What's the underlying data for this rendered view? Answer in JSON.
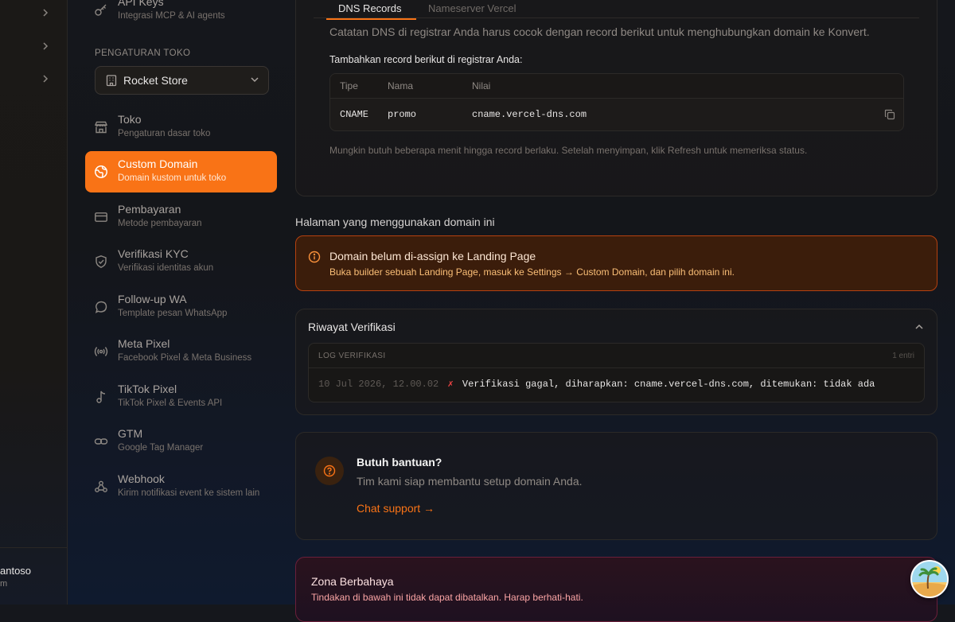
{
  "rail": {
    "user_name": "antoso",
    "user_sub": "m"
  },
  "sidebar": {
    "top_item": {
      "title": "API Keys",
      "subtitle": "Integrasi MCP & AI agents"
    },
    "section_label": "PENGATURAN TOKO",
    "store_select": {
      "value": "Rocket Store"
    },
    "items": [
      {
        "title": "Toko",
        "subtitle": "Pengaturan dasar toko",
        "icon": "store-icon"
      },
      {
        "title": "Custom Domain",
        "subtitle": "Domain kustom untuk toko",
        "icon": "globe-icon",
        "active": true
      },
      {
        "title": "Pembayaran",
        "subtitle": "Metode pembayaran",
        "icon": "credit-card-icon"
      },
      {
        "title": "Verifikasi KYC",
        "subtitle": "Verifikasi identitas akun",
        "icon": "shield-check-icon"
      },
      {
        "title": "Follow-up WA",
        "subtitle": "Template pesan WhatsApp",
        "icon": "chat-bubble-icon"
      },
      {
        "title": "Meta Pixel",
        "subtitle": "Facebook Pixel & Meta Business",
        "icon": "broadcast-icon"
      },
      {
        "title": "TikTok Pixel",
        "subtitle": "TikTok Pixel & Events API",
        "icon": "music-note-icon"
      },
      {
        "title": "GTM",
        "subtitle": "Google Tag Manager",
        "icon": "link-icon"
      },
      {
        "title": "Webhook",
        "subtitle": "Kirim notifikasi event ke sistem lain",
        "icon": "webhook-icon"
      }
    ]
  },
  "dns_card": {
    "tabs": [
      {
        "label": "DNS Records",
        "active": true
      },
      {
        "label": "Nameserver Vercel",
        "active": false
      }
    ],
    "description": "Catatan DNS di registrar Anda harus cocok dengan record berikut untuk menghubungkan domain ke Konvert.",
    "instruction": "Tambahkan record berikut di registrar Anda:",
    "table": {
      "headers": [
        "Tipe",
        "Nama",
        "Nilai"
      ],
      "rows": [
        {
          "type": "CNAME",
          "name": "promo",
          "value": "cname.vercel-dns.com"
        }
      ]
    },
    "note": "Mungkin butuh beberapa menit hingga record berlaku. Setelah menyimpan, klik Refresh untuk memeriksa status."
  },
  "pages_section": {
    "title": "Halaman yang menggunakan domain ini",
    "alert": {
      "title": "Domain belum di-assign ke Landing Page",
      "message": "Buka builder sebuah Landing Page, masuk ke Settings → Custom Domain, dan pilih domain ini."
    }
  },
  "verification": {
    "title": "Riwayat Verifikasi",
    "log_label": "LOG VERIFIKASI",
    "count": "1 entri",
    "entries": [
      {
        "time": "10 Jul 2026, 12.00.02",
        "mark": "✗",
        "message": "Verifikasi gagal, diharapkan: cname.vercel-dns.com, ditemukan: tidak ada"
      }
    ]
  },
  "help": {
    "title": "Butuh bantuan?",
    "subtitle": "Tim kami siap membantu setup domain Anda.",
    "link": "Chat support →"
  },
  "danger": {
    "title": "Zona Berbahaya",
    "subtitle": "Tindakan di bawah ini tidak dapat dibatalkan. Harap berhati-hati."
  },
  "colors": {
    "accent": "#f97316",
    "warning_bg": "#3a1c0a",
    "warning_border": "#c2410c",
    "error_mark": "#ef4444"
  }
}
